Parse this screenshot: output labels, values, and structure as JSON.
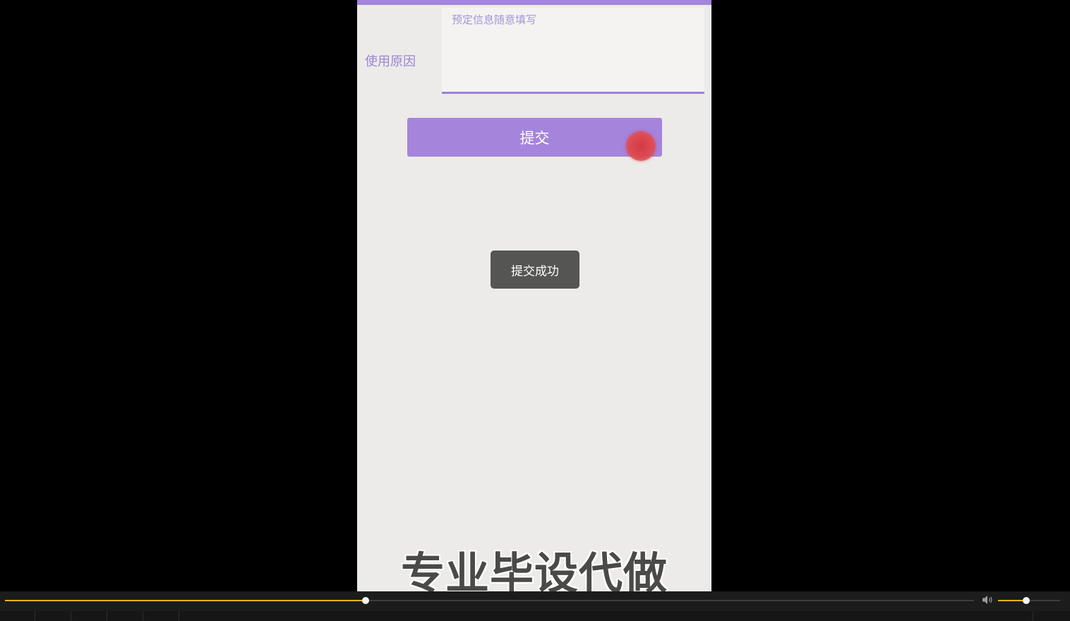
{
  "form": {
    "reason_label": "使用原因",
    "reason_placeholder": "预定信息随意填写"
  },
  "submit": {
    "label": "提交"
  },
  "toast": {
    "message": "提交成功"
  },
  "watermark": {
    "text": "专业毕设代做"
  },
  "player": {
    "progress": 0.372,
    "volume": 0.45,
    "accent_color": "#e8b418",
    "volume_icon": "speaker-icon"
  },
  "colors": {
    "primary": "#a584dc",
    "toast_bg": "#555553",
    "background": "#ecebe9"
  }
}
